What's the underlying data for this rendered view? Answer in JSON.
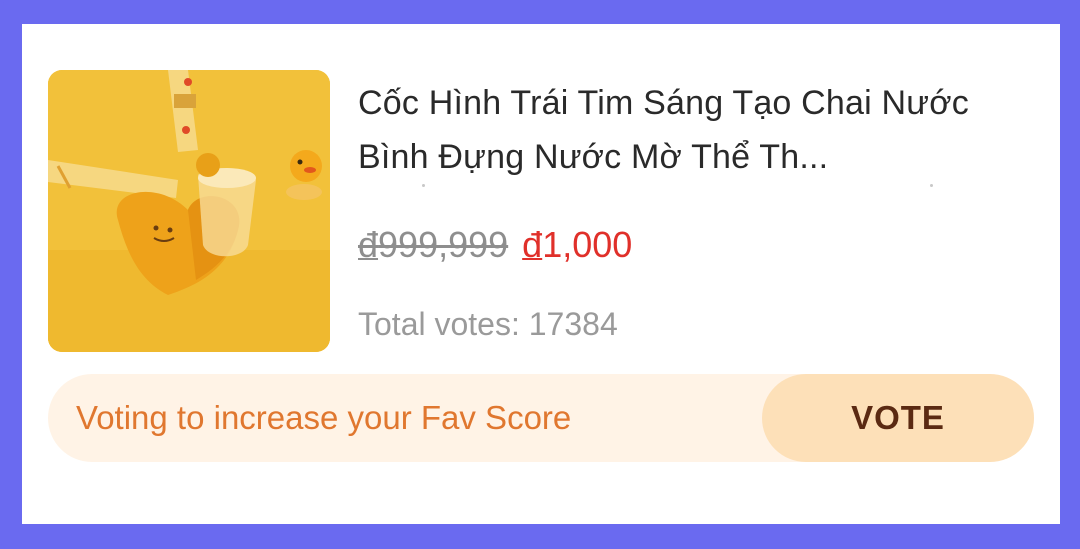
{
  "product": {
    "title": "Cốc Hình Trái Tim Sáng Tạo Chai Nước Bình Đựng Nước Mờ Thể Th...",
    "image_icon": "heart-water-bottle-image",
    "price": {
      "original_currency": "đ",
      "original_amount": "999,999",
      "sale_currency": "đ",
      "sale_amount": "1,000",
      "sale_color": "#e0302a"
    },
    "votes_text": "Total votes: 17384"
  },
  "vote_bar": {
    "message": "Voting to increase your Fav Score",
    "button_label": "VOTE",
    "accent_color": "#e0772f"
  },
  "colors": {
    "frame": "#6a6af0",
    "button_bg": "#fde0b8",
    "button_text": "#5b2a12"
  }
}
